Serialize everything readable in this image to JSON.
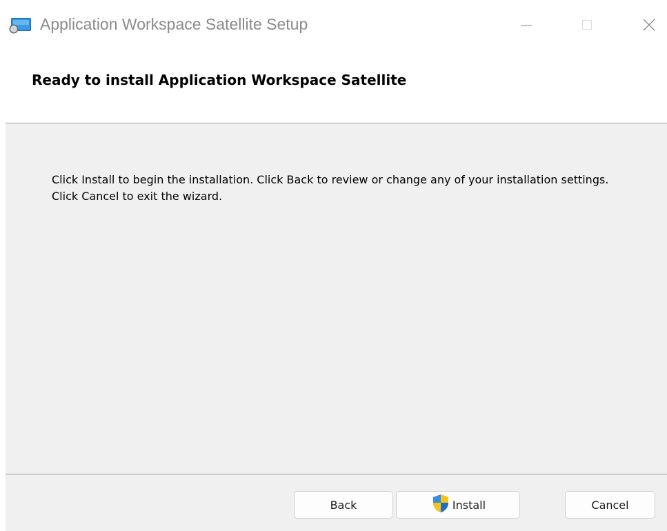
{
  "window": {
    "title": "Application Workspace Satellite Setup",
    "icon": "installer-app-icon",
    "controls": {
      "minimize": "minimize-icon",
      "maximize": "maximize-icon",
      "close": "close-icon"
    }
  },
  "header": {
    "title": "Ready to install Application Workspace Satellite"
  },
  "body": {
    "message": "Click Install to begin the installation. Click Back to review or change any of your installation settings. Click Cancel to exit the wizard."
  },
  "footer": {
    "back_label": "Back",
    "install_label": "Install",
    "install_icon": "uac-shield-icon",
    "cancel_label": "Cancel"
  },
  "colors": {
    "window_bg": "#ffffff",
    "body_bg": "#f0f0f0",
    "divider": "#a0a0a0",
    "title_text": "#8a8a8a",
    "shield_blue": "#2d7fd3",
    "shield_yellow": "#f5c518"
  }
}
